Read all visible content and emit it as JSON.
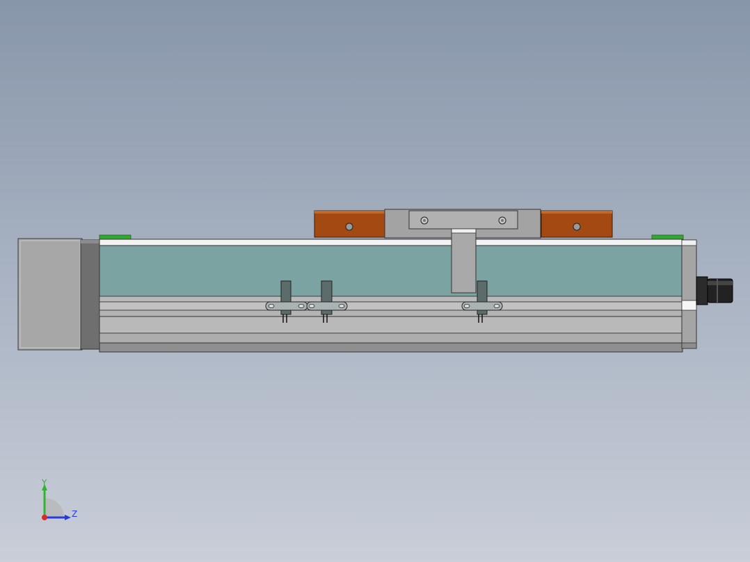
{
  "viewport": {
    "background_top": "#8896aa",
    "background_bottom": "#c9ced8"
  },
  "model": {
    "description_shown": false,
    "colors": {
      "motor_body": "#a7a7a7",
      "motor_flange": "#6f6f6f",
      "rail_window": "#7ba3a1",
      "rail_body": "#b9b9b9",
      "carriage_plate": "#a3a3a3",
      "slider_blocks": "#a34a12",
      "green_caps": "#35a832",
      "sensor_brackets": "#5b6c6b",
      "connector": "#222222"
    }
  },
  "triad": {
    "y_label": "Y",
    "z_label": "Z",
    "colors": {
      "y": "#2fb52f",
      "z": "#2a3bd9",
      "x": "#d92a2a"
    }
  }
}
